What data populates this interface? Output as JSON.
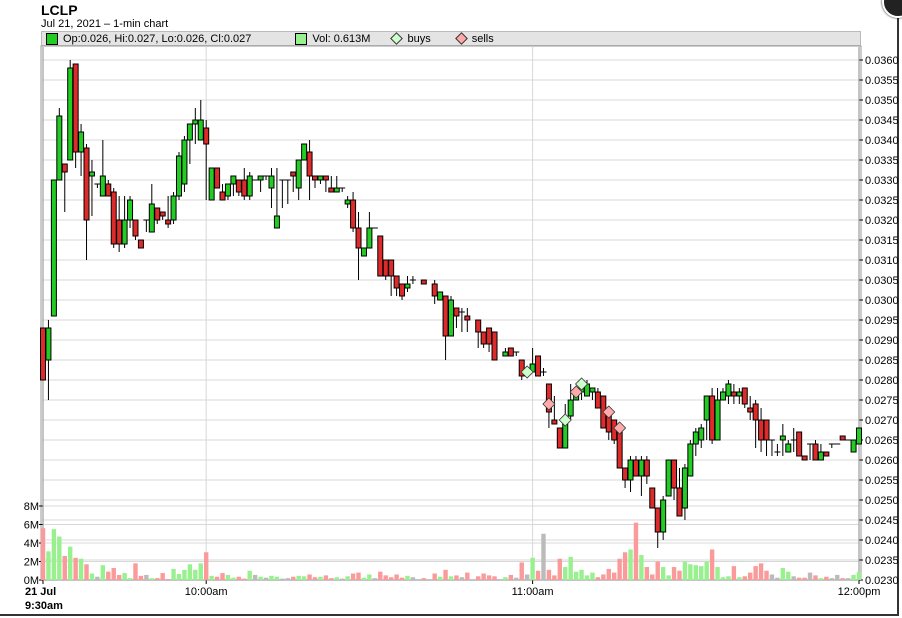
{
  "header": {
    "ticker": "LCLP",
    "subtitle": "Jul 21, 2021  – 1-min chart"
  },
  "legend": {
    "ohlc": "Op:0.026, Hi:0.027, Lo:0.026, Cl:0.027",
    "volume": "Vol: 0.613M",
    "buys": "buys",
    "sells": "sells"
  },
  "colors": {
    "up": "#22cc22",
    "down": "#dd2b2b",
    "vol_up": "#99f08f",
    "vol_down": "#fa9a9a",
    "vol_flat": "#bbbbbb",
    "buy": "#ccffcc",
    "sell": "#ffaaaa",
    "grid": "#d8d8d8"
  },
  "chart_data": {
    "type": "candlestick",
    "title": "LCLP",
    "price_axis": {
      "min": 0.023,
      "max": 0.036,
      "step": 0.0005,
      "side": "right",
      "tick_labels": [
        "0.0230",
        "0.0235",
        "0.0240",
        "0.0245",
        "0.0250",
        "0.0255",
        "0.0260",
        "0.0265",
        "0.0270",
        "0.0275",
        "0.0280",
        "0.0285",
        "0.0290",
        "0.0295",
        "0.0300",
        "0.0305",
        "0.0310",
        "0.0315",
        "0.0320",
        "0.0325",
        "0.0330",
        "0.0335",
        "0.0340",
        "0.0345",
        "0.0350",
        "0.0355",
        "0.0360"
      ]
    },
    "volume_axis": {
      "min": 0,
      "max": 8,
      "unit": "M",
      "tick_labels": [
        "0M",
        "2M",
        "4M",
        "6M",
        "8M"
      ],
      "ticks": [
        0,
        2,
        4,
        6,
        8
      ]
    },
    "time_axis": {
      "start_minutes": 0,
      "end_minutes": 150,
      "ticks": [
        {
          "t": 0,
          "label": "21 Jul",
          "sublabel": "9:30am"
        },
        {
          "t": 30,
          "label": "10:00am"
        },
        {
          "t": 90,
          "label": "11:00am"
        },
        {
          "t": 150,
          "label": "12:00pm"
        }
      ]
    },
    "candle_fields": [
      "minute",
      "open",
      "high",
      "low",
      "close",
      "volume_M"
    ],
    "candles": [
      [
        0,
        0.0293,
        0.0293,
        0.028,
        0.028,
        5.6
      ],
      [
        1,
        0.0285,
        0.0295,
        0.0275,
        0.0293,
        3.1
      ],
      [
        2,
        0.0296,
        0.033,
        0.0296,
        0.033,
        5.5
      ],
      [
        3,
        0.033,
        0.0348,
        0.033,
        0.0346,
        4.7
      ],
      [
        4,
        0.0334,
        0.0334,
        0.0322,
        0.0332,
        2.6
      ],
      [
        5,
        0.0335,
        0.036,
        0.0335,
        0.0358,
        3.6
      ],
      [
        6,
        0.0359,
        0.0359,
        0.0333,
        0.0337,
        2.4
      ],
      [
        7,
        0.0337,
        0.0344,
        0.0331,
        0.0342,
        2.3
      ],
      [
        8,
        0.0338,
        0.0339,
        0.031,
        0.032,
        1.7
      ],
      [
        9,
        0.0331,
        0.0335,
        0.0321,
        0.0332,
        0.7
      ],
      [
        10,
        0.0329,
        0.0329,
        0.0328,
        0.0329,
        0.35
      ],
      [
        11,
        0.0326,
        0.034,
        0.0326,
        0.0331,
        1.6
      ],
      [
        12,
        0.0329,
        0.033,
        0.0326,
        0.0326,
        0.9
      ],
      [
        13,
        0.0327,
        0.0328,
        0.0313,
        0.0314,
        1.3
      ],
      [
        14,
        0.032,
        0.0326,
        0.0312,
        0.0314,
        0.55
      ],
      [
        15,
        0.0314,
        0.0326,
        0.0313,
        0.032,
        0.75
      ],
      [
        16,
        0.032,
        0.0326,
        0.0318,
        0.0325,
        0.2
      ],
      [
        17,
        0.032,
        0.032,
        0.0315,
        0.0316,
        1.8
      ],
      [
        18,
        0.0315,
        0.0315,
        0.0313,
        0.0313,
        0.45
      ],
      [
        19,
        0.032,
        0.032,
        0.0317,
        0.032,
        0.55
      ],
      [
        20,
        0.0317,
        0.0329,
        0.0317,
        0.0324,
        0.2
      ],
      [
        21,
        0.0323,
        0.0323,
        0.0319,
        0.032,
        0.2
      ],
      [
        22,
        0.0322,
        0.0322,
        0.032,
        0.0321,
        0.75
      ],
      [
        23,
        0.032,
        0.0326,
        0.0318,
        0.0319,
        0.1
      ],
      [
        24,
        0.032,
        0.0327,
        0.0319,
        0.0326,
        1.2
      ],
      [
        25,
        0.0326,
        0.0337,
        0.0325,
        0.0336,
        0.65
      ],
      [
        26,
        0.0329,
        0.0341,
        0.0327,
        0.034,
        1.1
      ],
      [
        27,
        0.034,
        0.0343,
        0.0334,
        0.0344,
        1.7
      ],
      [
        28,
        0.0344,
        0.0348,
        0.0339,
        0.0345,
        1.1
      ],
      [
        29,
        0.034,
        0.035,
        0.034,
        0.0345,
        1.8
      ],
      [
        30,
        0.0343,
        0.0345,
        0.0325,
        0.0339,
        3.0
      ],
      [
        31,
        0.0325,
        0.0333,
        0.0325,
        0.0333,
        0.45
      ],
      [
        32,
        0.0333,
        0.0333,
        0.0328,
        0.0328,
        0.35
      ],
      [
        33,
        0.0327,
        0.0329,
        0.0325,
        0.0325,
        0.75
      ],
      [
        34,
        0.0326,
        0.0329,
        0.0325,
        0.0329,
        0.55
      ],
      [
        35,
        0.0329,
        0.0331,
        0.0326,
        0.0331,
        0.25
      ],
      [
        36,
        0.033,
        0.033,
        0.0326,
        0.0327,
        0.35
      ],
      [
        37,
        0.033,
        0.0333,
        0.0325,
        0.0326,
        0.15
      ],
      [
        38,
        0.0326,
        0.0332,
        0.0325,
        0.0331,
        1.0
      ],
      [
        39,
        0.033,
        0.033,
        0.033,
        0.033,
        0.55
      ],
      [
        40,
        0.033,
        0.0331,
        0.0327,
        0.0331,
        0.35
      ],
      [
        41,
        0.0331,
        0.0331,
        0.033,
        0.0331,
        0.25
      ],
      [
        42,
        0.0328,
        0.0333,
        0.0323,
        0.0331,
        0.45
      ],
      [
        43,
        0.0318,
        0.0333,
        0.0318,
        0.0321,
        0.35
      ],
      [
        44,
        0.033,
        0.033,
        0.0323,
        0.033,
        0.15
      ],
      [
        45,
        0.033,
        0.033,
        0.0324,
        0.033,
        0.2
      ],
      [
        46,
        0.0332,
        0.0332,
        0.0327,
        0.0331,
        0.35
      ],
      [
        47,
        0.0328,
        0.0333,
        0.0325,
        0.0335,
        0.45
      ],
      [
        48,
        0.0335,
        0.0339,
        0.0335,
        0.0339,
        0.4
      ],
      [
        49,
        0.0337,
        0.034,
        0.0325,
        0.0331,
        0.6
      ],
      [
        50,
        0.0331,
        0.0331,
        0.0328,
        0.033,
        0.3
      ],
      [
        51,
        0.033,
        0.0331,
        0.0329,
        0.0331,
        0.35
      ],
      [
        52,
        0.0331,
        0.0331,
        0.0327,
        0.033,
        0.5
      ],
      [
        53,
        0.0328,
        0.0331,
        0.0327,
        0.0327,
        0.2
      ],
      [
        54,
        0.0327,
        0.0331,
        0.0327,
        0.0328,
        0.3
      ],
      [
        55,
        0.0328,
        0.0328,
        0.0327,
        0.0328,
        0.15
      ],
      [
        56,
        0.0324,
        0.0326,
        0.0323,
        0.0325,
        0.4
      ],
      [
        57,
        0.0325,
        0.0327,
        0.0317,
        0.0318,
        0.7
      ],
      [
        58,
        0.0318,
        0.0322,
        0.0305,
        0.0313,
        0.8
      ],
      [
        59,
        0.0311,
        0.0313,
        0.0311,
        0.0313,
        0.25
      ],
      [
        60,
        0.0313,
        0.0322,
        0.0313,
        0.0318,
        0.6
      ],
      [
        61,
        0.0318,
        0.0318,
        0.0318,
        0.0318,
        0.2
      ],
      [
        62,
        0.0316,
        0.0316,
        0.0306,
        0.0306,
        0.9
      ],
      [
        63,
        0.031,
        0.031,
        0.0305,
        0.0306,
        0.5
      ],
      [
        64,
        0.031,
        0.031,
        0.0301,
        0.0306,
        0.3
      ],
      [
        65,
        0.0306,
        0.0306,
        0.0301,
        0.0303,
        0.6
      ],
      [
        66,
        0.0304,
        0.0304,
        0.03,
        0.0301,
        0.25
      ],
      [
        67,
        0.0303,
        0.0306,
        0.0302,
        0.0304,
        0.45
      ],
      [
        68,
        0.0305,
        0.0306,
        0.0304,
        0.0305,
        0.3
      ],
      [
        70,
        0.0305,
        0.0305,
        0.0304,
        0.0304,
        0.2
      ],
      [
        72,
        0.0304,
        0.0305,
        0.0299,
        0.0301,
        0.7
      ],
      [
        73,
        0.03,
        0.0302,
        0.03,
        0.0302,
        0.35
      ],
      [
        74,
        0.0301,
        0.0301,
        0.0285,
        0.0291,
        1.1
      ],
      [
        75,
        0.0291,
        0.0301,
        0.0291,
        0.03,
        0.4
      ],
      [
        76,
        0.0298,
        0.0298,
        0.0293,
        0.0296,
        0.5
      ],
      [
        77,
        0.0297,
        0.0298,
        0.0292,
        0.0297,
        0.3
      ],
      [
        78,
        0.0296,
        0.0298,
        0.0292,
        0.0295,
        0.8
      ],
      [
        80,
        0.0295,
        0.0295,
        0.0288,
        0.0292,
        0.4
      ],
      [
        81,
        0.0292,
        0.0292,
        0.0288,
        0.0289,
        0.7
      ],
      [
        82,
        0.0293,
        0.0293,
        0.0287,
        0.0289,
        0.5
      ],
      [
        83,
        0.0292,
        0.0292,
        0.0285,
        0.0285,
        0.4
      ],
      [
        85,
        0.0286,
        0.0288,
        0.0286,
        0.0287,
        0.3
      ],
      [
        86,
        0.0288,
        0.0288,
        0.0286,
        0.0286,
        0.55
      ],
      [
        87,
        0.0287,
        0.0287,
        0.0286,
        0.0287,
        0.25
      ],
      [
        88,
        0.0285,
        0.0285,
        0.028,
        0.0281,
        1.9
      ],
      [
        89,
        0.0282,
        0.0282,
        0.0281,
        0.0282,
        0.6
      ],
      [
        90,
        0.0282,
        0.0288,
        0.0282,
        0.0284,
        2.4
      ],
      [
        91,
        0.0286,
        0.0286,
        0.0281,
        0.0281,
        1.0
      ],
      [
        92,
        0.0282,
        0.0283,
        0.0281,
        0.0282,
        5.0
      ],
      [
        93,
        0.0279,
        0.0279,
        0.0268,
        0.0272,
        1.1
      ],
      [
        94,
        0.027,
        0.0276,
        0.0269,
        0.0269,
        0.5
      ],
      [
        95,
        0.0268,
        0.0268,
        0.0263,
        0.0263,
        2.3
      ],
      [
        96,
        0.0263,
        0.0274,
        0.0263,
        0.027,
        1.4
      ],
      [
        97,
        0.0271,
        0.0279,
        0.027,
        0.0275,
        2.5
      ],
      [
        98,
        0.0275,
        0.0278,
        0.0275,
        0.0277,
        0.9
      ],
      [
        99,
        0.0277,
        0.0279,
        0.0275,
        0.0278,
        1.1
      ],
      [
        100,
        0.0276,
        0.028,
        0.0276,
        0.0279,
        0.5
      ],
      [
        101,
        0.0277,
        0.0278,
        0.0275,
        0.0278,
        0.8
      ],
      [
        102,
        0.0277,
        0.0278,
        0.0274,
        0.0273,
        0.3
      ],
      [
        103,
        0.0276,
        0.0276,
        0.027,
        0.0268,
        0.6
      ],
      [
        104,
        0.0272,
        0.0272,
        0.0265,
        0.0267,
        1.2
      ],
      [
        105,
        0.027,
        0.027,
        0.0264,
        0.0265,
        0.8
      ],
      [
        106,
        0.0268,
        0.0268,
        0.0258,
        0.0258,
        2.3
      ],
      [
        107,
        0.0258,
        0.0258,
        0.0253,
        0.0255,
        3.0
      ],
      [
        108,
        0.0255,
        0.0261,
        0.0252,
        0.026,
        3.3
      ],
      [
        109,
        0.026,
        0.0261,
        0.0256,
        0.0256,
        6.2
      ],
      [
        110,
        0.0256,
        0.0261,
        0.0251,
        0.026,
        2.7
      ],
      [
        111,
        0.026,
        0.0261,
        0.0254,
        0.0256,
        1.4
      ],
      [
        112,
        0.0253,
        0.0253,
        0.0248,
        0.0248,
        0.6
      ],
      [
        113,
        0.0248,
        0.0248,
        0.0238,
        0.0242,
        2.0
      ],
      [
        114,
        0.0242,
        0.0251,
        0.024,
        0.025,
        1.4
      ],
      [
        115,
        0.0251,
        0.026,
        0.0251,
        0.026,
        0.5
      ],
      [
        116,
        0.026,
        0.026,
        0.025,
        0.0253,
        1.4
      ],
      [
        117,
        0.0253,
        0.0258,
        0.0246,
        0.0246,
        1.0
      ],
      [
        118,
        0.0248,
        0.0259,
        0.0245,
        0.0258,
        2.0
      ],
      [
        119,
        0.0256,
        0.0265,
        0.0256,
        0.0264,
        1.7
      ],
      [
        120,
        0.0264,
        0.0268,
        0.0261,
        0.0267,
        1.6
      ],
      [
        121,
        0.0265,
        0.0269,
        0.0263,
        0.0268,
        1.5
      ],
      [
        122,
        0.027,
        0.0276,
        0.0265,
        0.0276,
        2.0
      ],
      [
        123,
        0.0276,
        0.0278,
        0.0264,
        0.0265,
        3.3
      ],
      [
        124,
        0.0265,
        0.0278,
        0.0265,
        0.0275,
        1.4
      ],
      [
        125,
        0.0275,
        0.0278,
        0.0275,
        0.0277,
        0.3
      ],
      [
        126,
        0.0276,
        0.028,
        0.0274,
        0.0279,
        0.4
      ],
      [
        127,
        0.0277,
        0.0279,
        0.0274,
        0.0276,
        1.5
      ],
      [
        128,
        0.0276,
        0.0278,
        0.0274,
        0.0277,
        0.3
      ],
      [
        129,
        0.0278,
        0.0278,
        0.0273,
        0.0274,
        0.4
      ],
      [
        130,
        0.0273,
        0.0276,
        0.027,
        0.0272,
        0.8
      ],
      [
        131,
        0.0274,
        0.0275,
        0.0263,
        0.027,
        1.5
      ],
      [
        132,
        0.027,
        0.0273,
        0.0262,
        0.0265,
        1.8
      ],
      [
        133,
        0.027,
        0.027,
        0.0261,
        0.0265,
        1.0
      ],
      [
        134,
        0.0265,
        0.0265,
        0.0261,
        0.0265,
        0.6
      ],
      [
        135,
        0.0262,
        0.0264,
        0.0261,
        0.0262,
        0.25
      ],
      [
        136,
        0.0265,
        0.0269,
        0.0261,
        0.0266,
        1.3
      ],
      [
        137,
        0.0262,
        0.0265,
        0.0262,
        0.0264,
        0.9
      ],
      [
        138,
        0.0265,
        0.0268,
        0.0262,
        0.0265,
        0.4
      ],
      [
        139,
        0.0267,
        0.0267,
        0.0261,
        0.0261,
        0.25
      ],
      [
        140,
        0.0261,
        0.0261,
        0.026,
        0.026,
        0.25
      ],
      [
        141,
        0.0264,
        0.0264,
        0.026,
        0.0264,
        0.8
      ],
      [
        142,
        0.0264,
        0.0265,
        0.026,
        0.026,
        0.5
      ],
      [
        143,
        0.026,
        0.0264,
        0.026,
        0.0262,
        0.2
      ],
      [
        144,
        0.0262,
        0.0262,
        0.0261,
        0.0261,
        0.35
      ],
      [
        145,
        0.0264,
        0.0264,
        0.0263,
        0.0264,
        0.2
      ],
      [
        146,
        0.0264,
        0.0264,
        0.0264,
        0.0264,
        0.55
      ],
      [
        147,
        0.0266,
        0.0266,
        0.0265,
        0.0265,
        0.2
      ],
      [
        148,
        0.0265,
        0.0265,
        0.0265,
        0.0265,
        0.2
      ],
      [
        149,
        0.0262,
        0.0265,
        0.0262,
        0.0265,
        0.55
      ],
      [
        150,
        0.0264,
        0.0268,
        0.0264,
        0.0268,
        0.85
      ]
    ],
    "buys": [
      [
        89,
        0.0282
      ],
      [
        96,
        0.027
      ],
      [
        99,
        0.0279
      ]
    ],
    "sells": [
      [
        93,
        0.0274
      ],
      [
        98,
        0.0277
      ],
      [
        104,
        0.0272
      ],
      [
        106,
        0.0268
      ]
    ],
    "grid": true,
    "legend_placement": "top"
  }
}
